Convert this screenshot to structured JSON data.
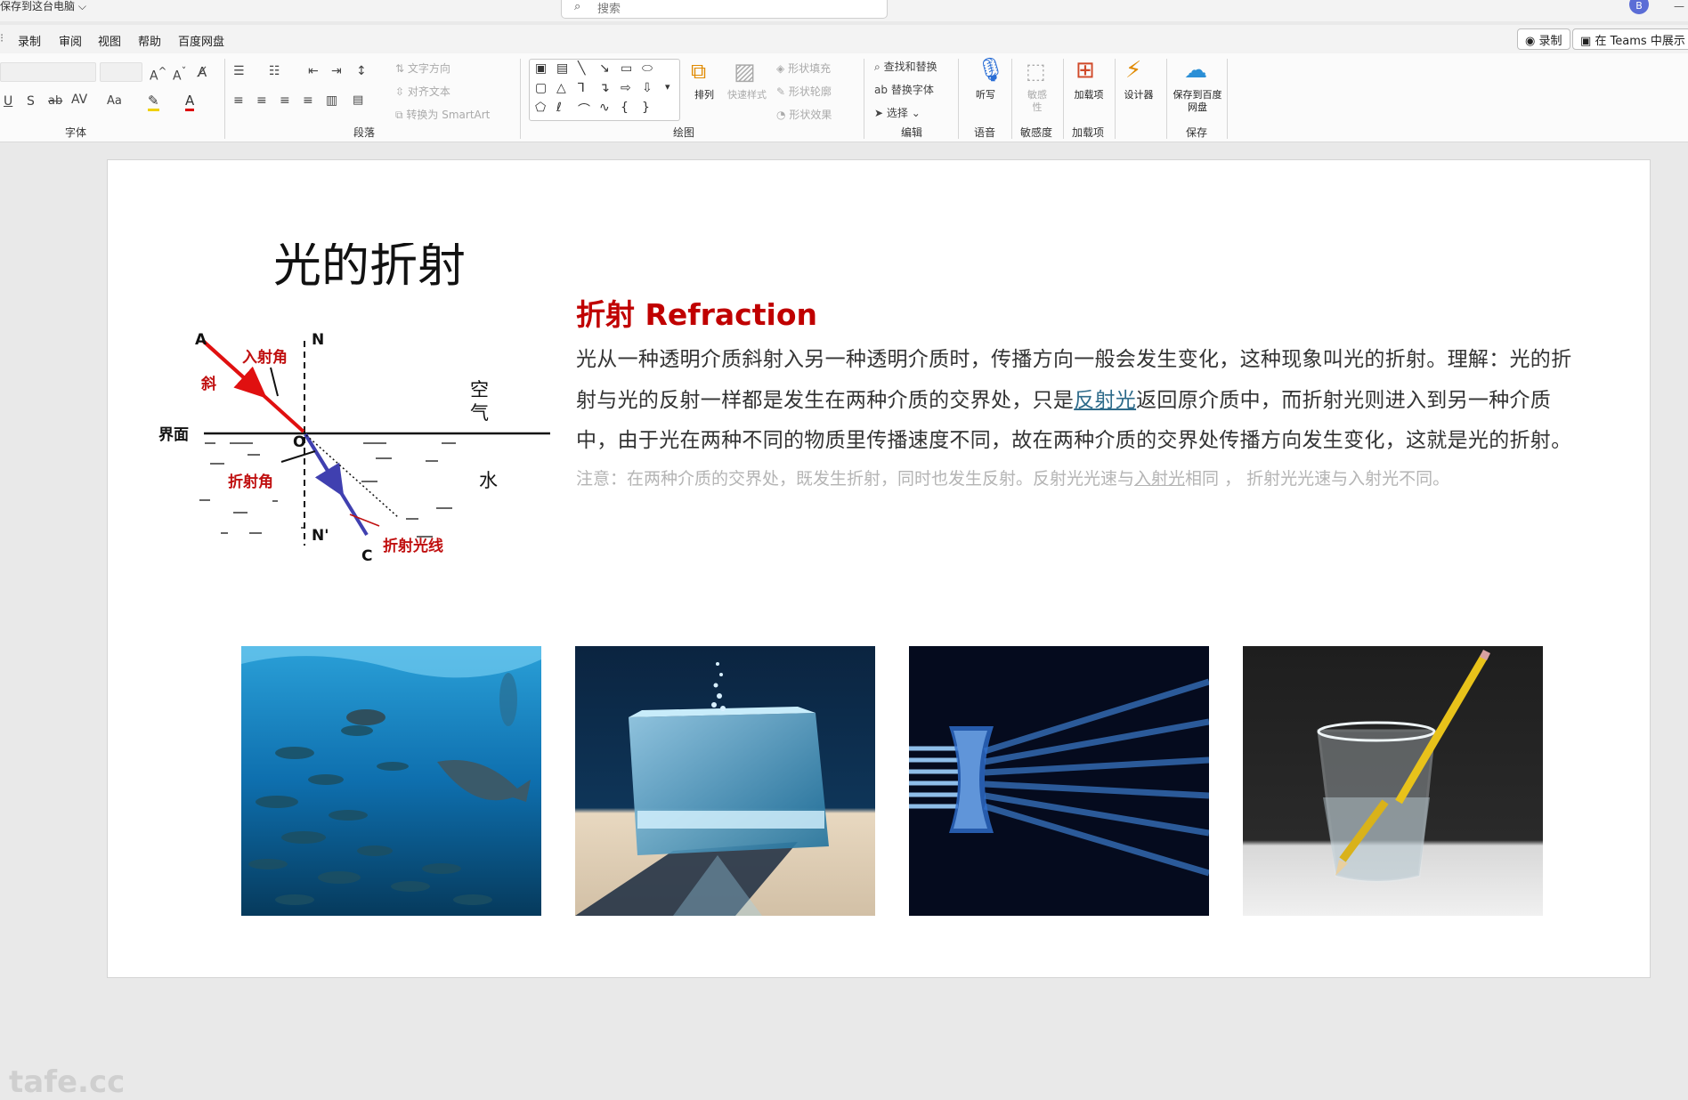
{
  "titlebar": {
    "save_location": "保存到这台电脑",
    "search_placeholder": "搜索",
    "avatar_initial": "B",
    "minimize": "—"
  },
  "menu": {
    "tabs": [
      "录制",
      "审阅",
      "视图",
      "帮助",
      "百度网盘"
    ],
    "record_button": "录制",
    "teams_button": "在 Teams 中展示"
  },
  "ribbon": {
    "groups": {
      "font": "字体",
      "paragraph": "段落",
      "drawing": "绘图",
      "editing": "编辑",
      "voice": "语音",
      "sensitivity": "敏感度",
      "addins": "加载项",
      "save": "保存"
    },
    "paragraph": {
      "text_direction": "文字方向",
      "align_text": "对齐文本",
      "convert_smartart": "转换为 SmartArt"
    },
    "drawing": {
      "arrange": "排列",
      "quick_styles": "快速样式",
      "shape_fill": "形状填充",
      "shape_outline": "形状轮廓",
      "shape_effects": "形状效果"
    },
    "editing": {
      "find_replace": "查找和替换",
      "replace_font": "替换字体",
      "select": "选择"
    },
    "voice": {
      "dictate": "听写"
    },
    "sensitivity": {
      "label": "敏感性"
    },
    "addins": {
      "label": "加载项"
    },
    "designer": {
      "label": "设计器"
    },
    "baidu": {
      "label": "保存到百度网盘"
    }
  },
  "slide": {
    "diagram": {
      "title": "光的折射",
      "label_A": "A",
      "label_N_top": "N",
      "label_incidence_angle": "入射角",
      "label_oblique": "斜",
      "label_air": "空气",
      "label_interface": "界面",
      "label_O": "O",
      "label_refraction_angle": "折射角",
      "label_water": "水",
      "label_N_bottom": "N'",
      "label_C": "C",
      "label_refracted_ray": "折射光线"
    },
    "heading": "折射 Refraction",
    "body_before_link": "光从一种透明介质斜射入另一种透明介质时，传播方向一般会发生变化，这种现象叫光的折射。理解：光的折射与光的反射一样都是发生在两种介质的交界处，只是",
    "body_link": "反射光",
    "body_after_link": "返回原介质中，而折射光则进入到另一种介质中，由于光在两种不同的物质里传播速度不同，故在两种介质的交界处传播方向发生变化，这就是光的折射。",
    "note_before": "注意：在两种介质的交界处，既发生折射，同时也发生反射。反射光光速与",
    "note_underlined": "入射光",
    "note_after": "相同 ， 折射光光速与入射光不同。",
    "photos": [
      "underwater-fish",
      "glass-cube",
      "light-through-lens",
      "pencil-in-water"
    ]
  },
  "watermark": "tafe.cc",
  "colors": {
    "accent_red": "#c00000",
    "link_blue": "#2e6b8a",
    "ray_incident": "#e01010",
    "ray_refracted": "#4040b0"
  }
}
